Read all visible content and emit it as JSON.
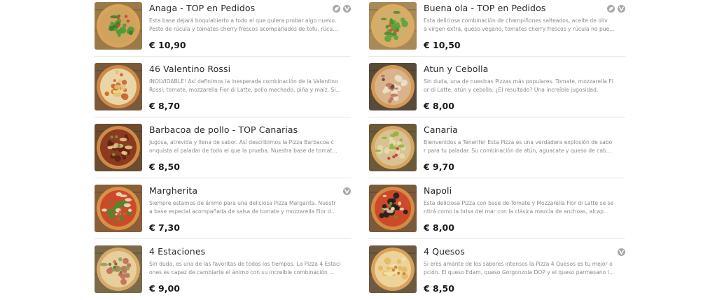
{
  "menu": {
    "left": [
      {
        "name": "Anaga - TOP en Pedidos",
        "desc": [
          "Esta base dejará boquiabierto a todo el que quiera probar algo nuevo.",
          "Pesto de rúcula y tomates cherry frescos acompañados de tofu, rúcu..."
        ],
        "price": "€ 10,90",
        "badges": [
          "leaf-icon",
          "vegan-icon"
        ],
        "style": "rucula"
      },
      {
        "name": "46 Valentino Rossi",
        "desc": [
          "INOLVIDABLE! Así definimos la inesperada combinación de la Valentino",
          "Rossi; tomate, mozzarella Fior di Latte, pollo mechado, piña y maíz. Si..."
        ],
        "price": "€ 8,70",
        "badges": [],
        "style": "valentino"
      },
      {
        "name": "Barbacoa de pollo - TOP Canarias",
        "desc": [
          "Jugosa, atrevida y llena de sabor. Así describimos la Pizza Barbacoa c",
          "onquista el paladar de todo el que la prueba. Nuestra base de tomat..."
        ],
        "price": "€ 8,50",
        "badges": [],
        "style": "barbacoa"
      },
      {
        "name": "Margherita",
        "desc": [
          "Siempre estamos de ánimo para una deliciosa Pizza Margarita. Nuestr",
          "a base especial acompañada de salsa de tomate y mozzarella Fior d..."
        ],
        "price": "€ 7,30",
        "badges": [
          "vegan-icon"
        ],
        "style": "margherita"
      },
      {
        "name": "4 Estaciones",
        "desc": [
          "Sin duda, es una de las favoritas de todos los tiempos. La Pizza 4 Estaci",
          "ones es capaz de cambiarte el ánimo con su increíble combinación ..."
        ],
        "price": "€ 9,00",
        "badges": [],
        "style": "estaciones"
      }
    ],
    "right": [
      {
        "name": "Buena ola - TOP en Pedidos",
        "desc": [
          "Esta deliciosa combinación de champiñones salteados, aceite de oliv",
          "a virgen extra, queso vegano, tomates cherry frescos y rúcula no pue..."
        ],
        "price": "€ 10,50",
        "badges": [
          "leaf-icon",
          "vegan-icon"
        ],
        "style": "rucula2"
      },
      {
        "name": "Atun y Cebolla",
        "desc": [
          "Sin duda, una de nuestras Pizzas más populares. Tomate, mozzarella Fi",
          "or di Latte, atún y cebolla. ¿El resultado? Una increíble jugosidad."
        ],
        "price": "€ 8,00",
        "badges": [],
        "style": "atun"
      },
      {
        "name": "Canaria",
        "desc": [
          "Bienvenidos a Tenerife! Esta Pizza es una verdadera explosión de sabo",
          "r para tu paladar. Su combinación de atún, aguacate y queso de cab..."
        ],
        "price": "€ 9,70",
        "badges": [],
        "style": "canaria"
      },
      {
        "name": "Napoli",
        "desc": [
          "Esta deliciosa Pizza con base de Tomate y Mozzarella Fior di Latte se se",
          "ntirá como la brisa del mar con la clásica mezcla de anchoas, alcap..."
        ],
        "price": "€ 8,00",
        "badges": [],
        "style": "napoli"
      },
      {
        "name": "4 Quesos",
        "desc": [
          "Si eres amante de los sabores intensos la Pizza 4 Quesos es tu mejor o",
          "pción. El queso Edam, queso Gorgonzola DOP y el queso parmesano l..."
        ],
        "price": "€ 8,50",
        "badges": [
          "vegan-icon"
        ],
        "style": "quesos"
      }
    ]
  }
}
